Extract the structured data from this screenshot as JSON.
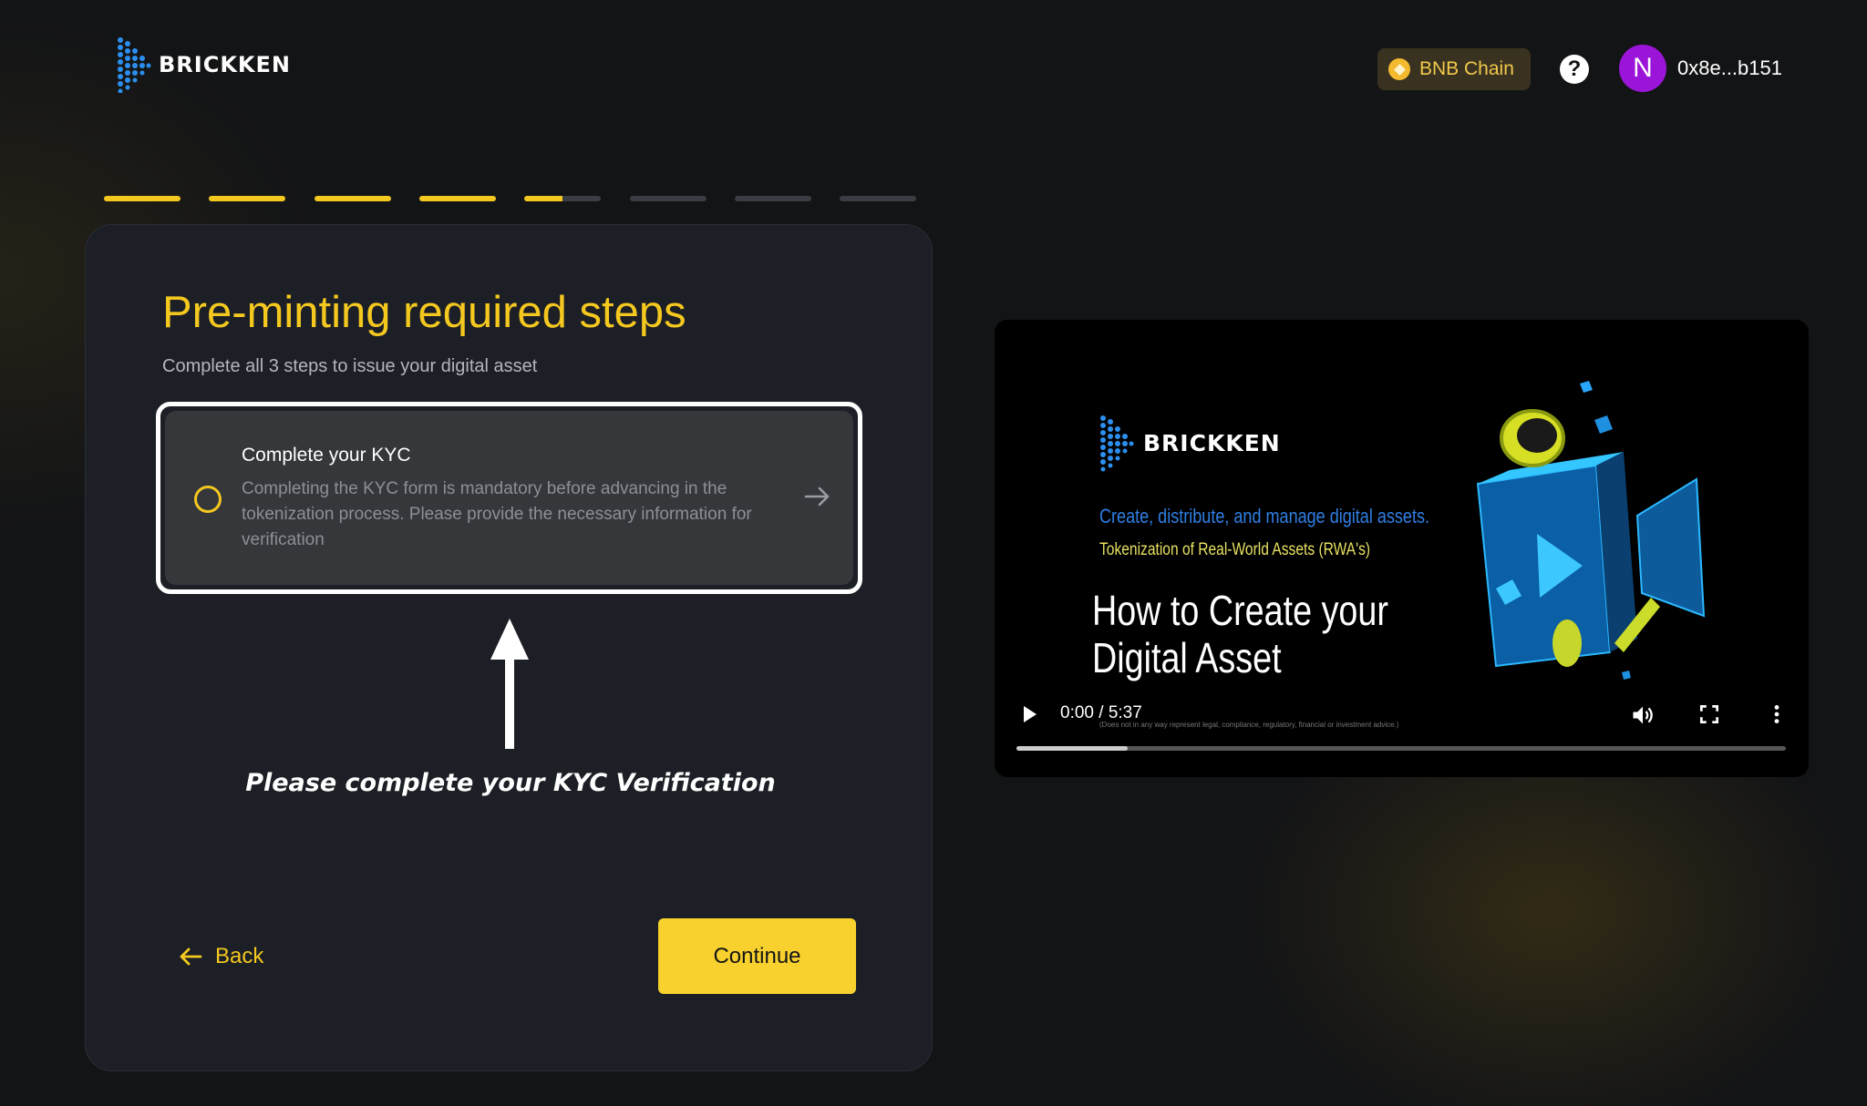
{
  "header": {
    "brand": "BRICKKEN",
    "network_label": "BNB Chain",
    "help_glyph": "?",
    "avatar_initial": "N",
    "wallet_address": "0x8e...b151"
  },
  "progress": {
    "total_steps": 8,
    "segment_fill": [
      1,
      1,
      1,
      1,
      0.5,
      0,
      0,
      0
    ]
  },
  "main": {
    "title": "Pre-minting required steps",
    "subtitle": "Complete all 3 steps to issue your digital asset",
    "steps": [
      {
        "title": "Complete your KYC",
        "description": "Completing the KYC form is mandatory before advancing in the tokenization process. Please provide the necessary information for verification",
        "status": "pending"
      }
    ],
    "callout": "Please complete your KYC Verification",
    "back_label": "Back",
    "continue_label": "Continue"
  },
  "video": {
    "brand": "BRICKKEN",
    "tagline": "Create, distribute, and manage digital assets.",
    "subtagline": "Tokenization of Real-World Assets (RWA's)",
    "title": "How to Create your Digital Asset",
    "disclaimer": "(Does not in any way represent legal, compliance, regulatory, financial or investment advice.)",
    "time": "0:00 / 5:37",
    "buffered_fraction": 0.145
  },
  "colors": {
    "accent": "#f4c81f",
    "background": "#131416",
    "card": "#1c1f25",
    "avatar": "#9b15d8",
    "video_blue": "#2f7fe3"
  },
  "icons": [
    "brickken-logo-icon",
    "bnb-coin-icon",
    "help-icon",
    "radio-empty-icon",
    "arrow-right-icon",
    "arrow-up-icon",
    "arrow-left-icon",
    "play-icon",
    "volume-icon",
    "fullscreen-icon",
    "more-vert-icon"
  ]
}
